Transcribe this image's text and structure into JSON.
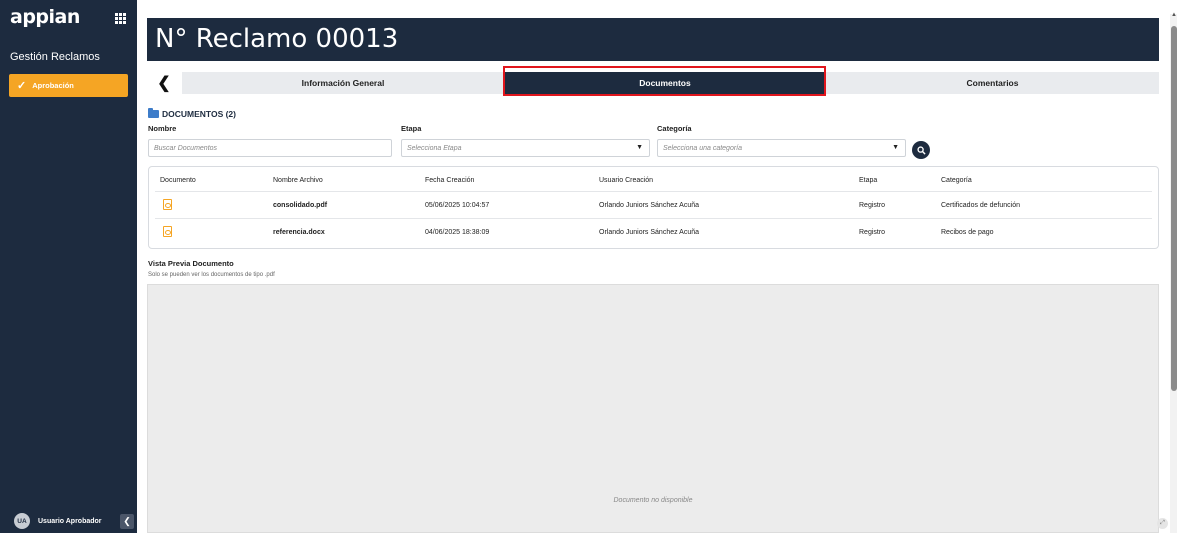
{
  "sidebar": {
    "logo": "appian",
    "app_name": "Gestión Reclamos",
    "nav_item_label": "Aprobación",
    "user_initials": "UA",
    "user_name": "Usuario Aprobador"
  },
  "header": {
    "title": "N° Reclamo 00013"
  },
  "tabs": {
    "general": "Información General",
    "documents": "Documentos",
    "comments": "Comentarios"
  },
  "documents": {
    "section_title": "DOCUMENTOS (2)",
    "filters": {
      "name_label": "Nombre",
      "name_placeholder": "Buscar Documentos",
      "stage_label": "Etapa",
      "stage_placeholder": "Selecciona Etapa",
      "category_label": "Categoría",
      "category_placeholder": "Selecciona una categoría"
    },
    "columns": [
      "Documento",
      "Nombre Archivo",
      "Fecha Creación",
      "Usuario Creación",
      "Etapa",
      "Categoría"
    ],
    "rows": [
      {
        "file": "consolidado.pdf",
        "date": "05/06/2025 10:04:57",
        "user": "Orlando Juniors Sánchez Acuña",
        "stage": "Registro",
        "category": "Certificados de defunción"
      },
      {
        "file": "referencia.docx",
        "date": "04/06/2025 18:38:09",
        "user": "Orlando Juniors Sánchez Acuña",
        "stage": "Registro",
        "category": "Recibos de pago"
      }
    ]
  },
  "preview": {
    "title": "Vista Previa Documento",
    "subtitle": "Solo se pueden ver los documentos de tipo .pdf",
    "not_available": "Documento no disponible"
  },
  "colors": {
    "navy": "#1d2b3f",
    "accent": "#f5a524",
    "highlight": "#e0161d"
  }
}
